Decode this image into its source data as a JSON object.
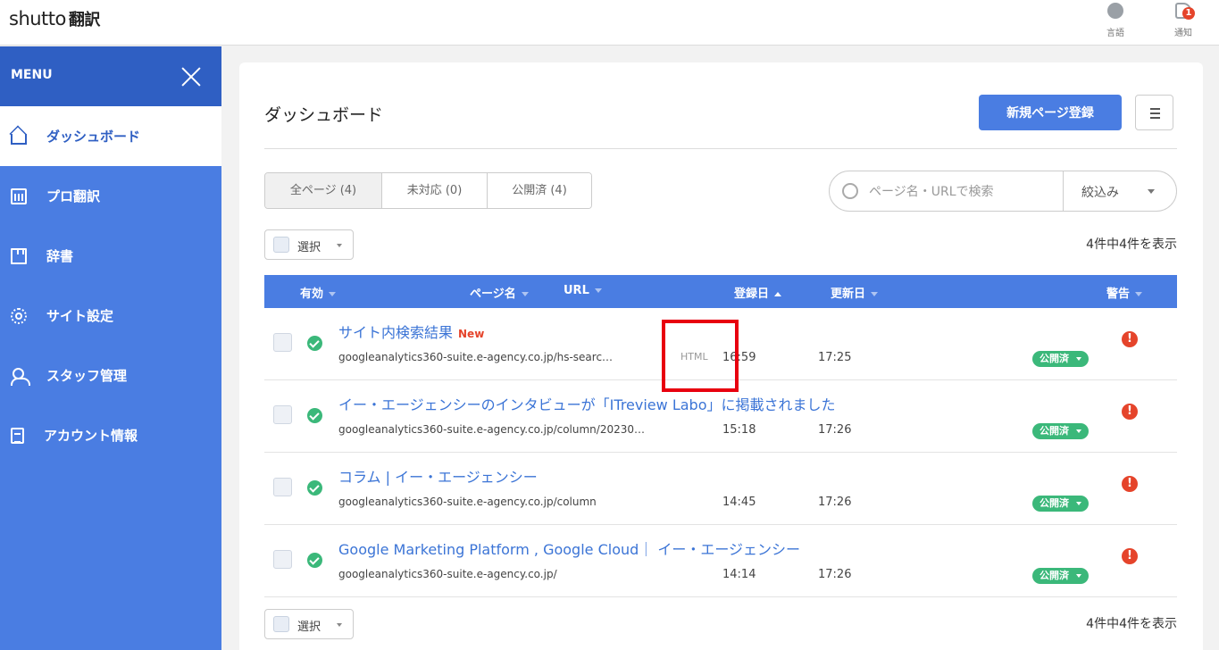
{
  "header": {
    "logo": "shutto",
    "logo_jp": "翻訳",
    "lang_label": "言語",
    "notify_label": "通知",
    "notify_count": "1"
  },
  "sidebar": {
    "menu_label": "MENU",
    "items": [
      {
        "label": "ダッシュボード",
        "icon": "home-icon",
        "active": true
      },
      {
        "label": "プロ翻訳",
        "icon": "calendar-icon"
      },
      {
        "label": "辞書",
        "icon": "book-icon"
      },
      {
        "label": "サイト設定",
        "icon": "gear-icon"
      },
      {
        "label": "スタッフ管理",
        "icon": "staff-icon"
      },
      {
        "label": "アカウント情報",
        "icon": "document-icon"
      }
    ]
  },
  "main": {
    "title": "ダッシュボード",
    "new_page_button": "新規ページ登録",
    "tabs": [
      {
        "label": "全ページ (4)",
        "active": true
      },
      {
        "label": "未対応 (0)"
      },
      {
        "label": "公開済 (4)"
      }
    ],
    "search": {
      "placeholder": "ページ名・URLで検索",
      "value": ""
    },
    "filter_label": "絞込み",
    "select_label": "選択",
    "count_text": "4件中4件を表示",
    "columns": {
      "enabled": "有効",
      "page_name": "ページ名",
      "url": "URL",
      "registered": "登録日",
      "updated": "更新日",
      "warning": "警告"
    },
    "rows": [
      {
        "name": "サイト内検索結果",
        "new_tag": "New",
        "url": "googleanalytics360-suite.e-agency.co.jp/hs-searc…",
        "html_tag": "HTML",
        "registered": "16:59",
        "updated": "17:25",
        "status": "公開済",
        "warning": "!"
      },
      {
        "name": "イー・エージェンシーのインタビューが「ITreview Labo」に掲載されました",
        "new_tag": "",
        "url": "googleanalytics360-suite.e-agency.co.jp/column/20230…",
        "html_tag": "",
        "registered": "15:18",
        "updated": "17:26",
        "status": "公開済",
        "warning": "!"
      },
      {
        "name": "コラム | イー・エージェンシー",
        "new_tag": "",
        "url": "googleanalytics360-suite.e-agency.co.jp/column",
        "html_tag": "",
        "registered": "14:45",
        "updated": "17:26",
        "status": "公開済",
        "warning": "!"
      },
      {
        "name": "Google Marketing Platform , Google Cloud｜ イー・エージェンシー",
        "new_tag": "",
        "url": "googleanalytics360-suite.e-agency.co.jp/",
        "html_tag": "",
        "registered": "14:14",
        "updated": "17:26",
        "status": "公開済",
        "warning": "!"
      }
    ]
  },
  "colors": {
    "accent": "#4a7de2",
    "sidebar_header": "#2f5fc3",
    "success": "#3bb87a",
    "danger": "#e5442b",
    "highlight": "#e8000f"
  }
}
